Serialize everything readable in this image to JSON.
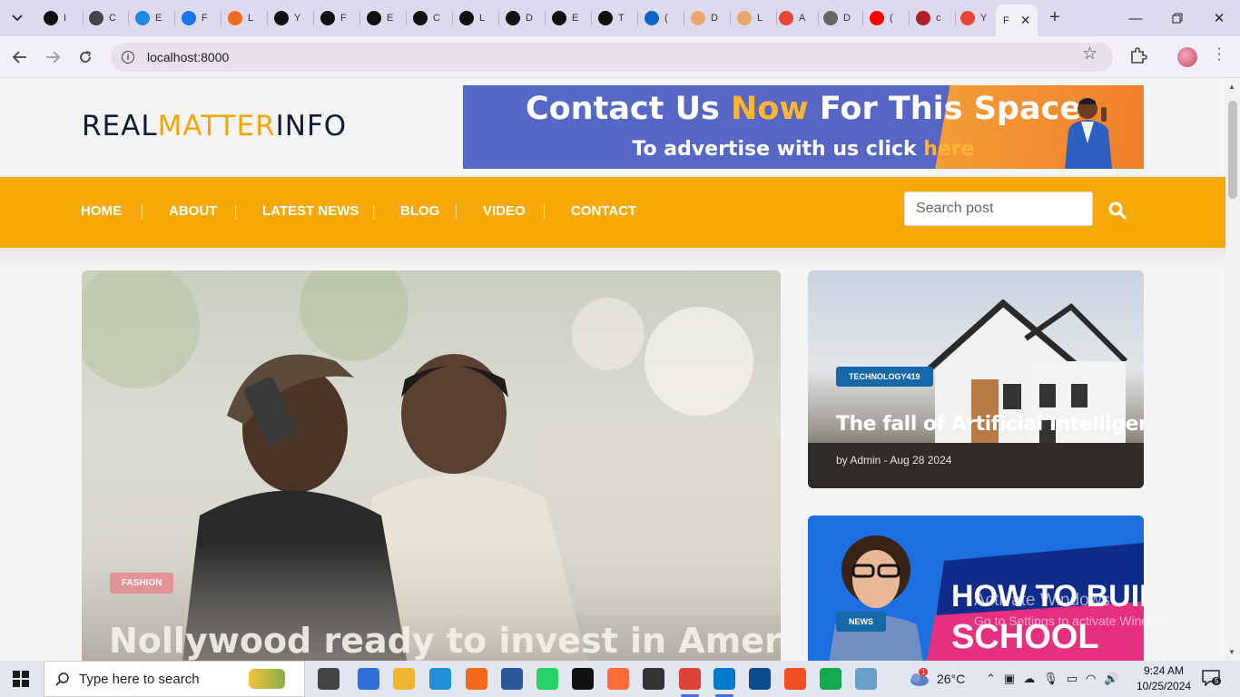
{
  "browser": {
    "tabs": [
      {
        "label": "I",
        "icon": "openai-icon",
        "color": "#111111"
      },
      {
        "label": "C",
        "icon": "chatgpt-icon",
        "color": "#444444"
      },
      {
        "label": "E",
        "icon": "ef-icon",
        "color": "#1e88e5"
      },
      {
        "label": "F",
        "icon": "facebook-icon",
        "color": "#1877f2"
      },
      {
        "label": "L",
        "icon": "xampp-icon",
        "color": "#f26b1d"
      },
      {
        "label": "Y",
        "icon": "upwork-icon",
        "color": "#111111"
      },
      {
        "label": "F",
        "icon": "upwork-icon",
        "color": "#111111"
      },
      {
        "label": "E",
        "icon": "upwork-icon",
        "color": "#111111"
      },
      {
        "label": "C",
        "icon": "upwork-icon",
        "color": "#111111"
      },
      {
        "label": "L",
        "icon": "upwork-icon",
        "color": "#111111"
      },
      {
        "label": "D",
        "icon": "upwork-icon",
        "color": "#111111"
      },
      {
        "label": "E",
        "icon": "upwork-icon",
        "color": "#111111"
      },
      {
        "label": "T",
        "icon": "upwork-icon",
        "color": "#111111"
      },
      {
        "label": "(",
        "icon": "linkedin-icon",
        "color": "#0a66c2"
      },
      {
        "label": "D",
        "icon": "loading-icon",
        "color": "#e8a86a"
      },
      {
        "label": "L",
        "icon": "loading-icon",
        "color": "#e8a86a"
      },
      {
        "label": "A",
        "icon": "gmail-icon",
        "color": "#ea4335"
      },
      {
        "label": "D",
        "icon": "globe-icon",
        "color": "#666666"
      },
      {
        "label": "(",
        "icon": "youtube-icon",
        "color": "#ff0000"
      },
      {
        "label": "c",
        "icon": "cbar-icon",
        "color": "#b0202a"
      },
      {
        "label": "Y",
        "icon": "gmail-icon",
        "color": "#ea4335"
      }
    ],
    "active_tab_label": "F",
    "url": "localhost:8000"
  },
  "site": {
    "logo": {
      "part1": "REAL",
      "part2": "MATTER",
      "part3": "INFO"
    },
    "ad": {
      "line1_a": "Contact Us ",
      "line1_hl": "Now",
      "line1_b": " For This Space",
      "line2_a": "To advertise with us click ",
      "line2_hl": "here"
    },
    "nav": [
      "HOME",
      "ABOUT",
      "LATEST NEWS",
      "BLOG",
      "VIDEO",
      "CONTACT"
    ],
    "search_placeholder": "Search post",
    "featured": {
      "badge": "FASHION",
      "title": "Nollywood ready to invest in America"
    },
    "card1": {
      "badge": "TECHNOLOGY419",
      "title": "The fall of Artificial Intelligence",
      "meta": "by Admin - Aug 28 2024"
    },
    "card2": {
      "badge": "NEWS",
      "image_text_1": "HOW TO BUILD",
      "image_text_2": "SCHOOL"
    },
    "colors": {
      "accent": "#f7a907",
      "navy": "#0f1e38",
      "badge_blue": "#1569a8"
    }
  },
  "os": {
    "watermark_title": "Activate Windows",
    "watermark_sub": "Go to Settings to activate Windows.",
    "taskbar_search": "Type here to search",
    "weather": "26°C",
    "time": "9:24 AM",
    "date": "10/25/2024",
    "notifications": "5",
    "weather_badge": "1"
  }
}
